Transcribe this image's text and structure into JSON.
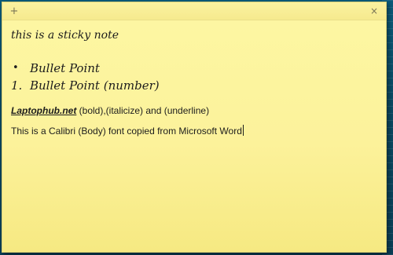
{
  "titlebar": {
    "add_glyph": "+",
    "close_glyph": "×"
  },
  "note": {
    "line1": "this is a sticky note",
    "bullet_glyph": "•",
    "bullet_item": "Bullet Point",
    "number_label": "1.",
    "number_item": "Bullet Point (number)",
    "brand_text": "Laptophub.net",
    "format_text": " (bold),(italicize) and (underline)",
    "calibri_text": "This is a Calibri (Body) font copied from Microsoft Word"
  },
  "colors": {
    "note_background": "#fcf29b",
    "desktop_background": "#0a4a63"
  },
  "icons": {
    "add": "plus-icon",
    "close": "close-icon"
  }
}
